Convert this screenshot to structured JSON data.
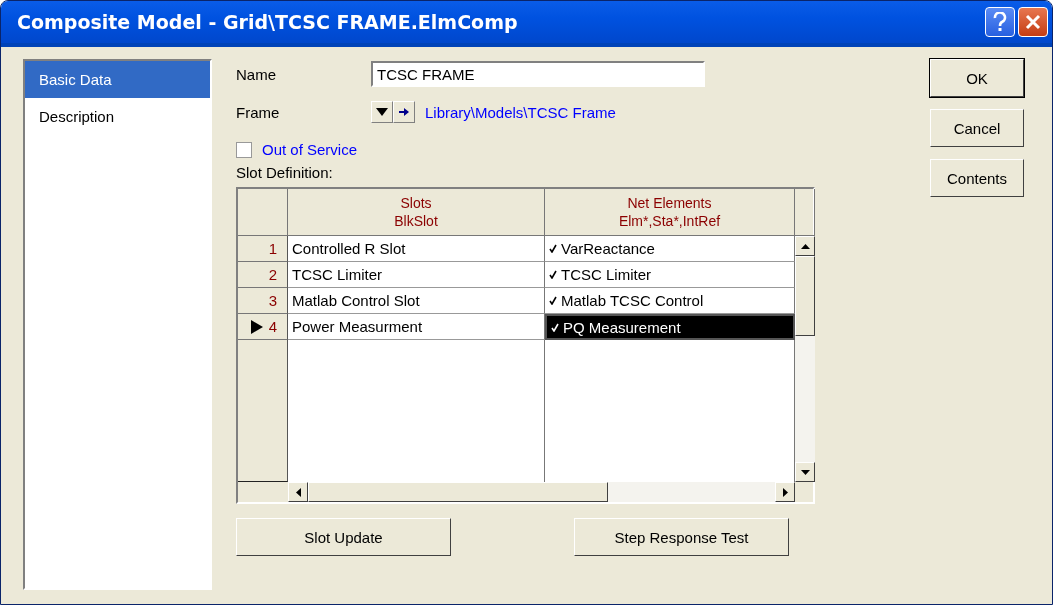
{
  "window": {
    "title": "Composite Model - Grid\\TCSC FRAME.ElmComp"
  },
  "sidebar": {
    "items": [
      {
        "label": "Basic Data",
        "selected": true
      },
      {
        "label": "Description",
        "selected": false
      }
    ]
  },
  "name_field": {
    "label": "Name",
    "value": "TCSC FRAME"
  },
  "frame": {
    "label": "Frame",
    "link": "Library\\Models\\TCSC Frame"
  },
  "out_of_service": {
    "label": "Out of Service",
    "checked": false
  },
  "slot_definition": {
    "label": "Slot Definition:",
    "columns": [
      {
        "title": "Slots",
        "subtitle": "BlkSlot"
      },
      {
        "title": "Net Elements",
        "subtitle": "Elm*,Sta*,IntRef"
      }
    ],
    "rows": [
      {
        "number": "1",
        "slot": "Controlled R Slot",
        "element": "VarReactance",
        "selected": false
      },
      {
        "number": "2",
        "slot": "TCSC Limiter",
        "element": "TCSC Limiter",
        "selected": false
      },
      {
        "number": "3",
        "slot": "Matlab Control Slot",
        "element": "Matlab TCSC Control",
        "selected": false
      },
      {
        "number": "4",
        "slot": "Power Measurment",
        "element": "PQ Measurement",
        "selected": true
      }
    ]
  },
  "bottom_buttons": [
    "Slot Update",
    "Step Response Test"
  ],
  "side_buttons": [
    {
      "label": "OK",
      "default": true
    },
    {
      "label": "Cancel",
      "default": false
    },
    {
      "label": "Contents",
      "default": false
    }
  ]
}
